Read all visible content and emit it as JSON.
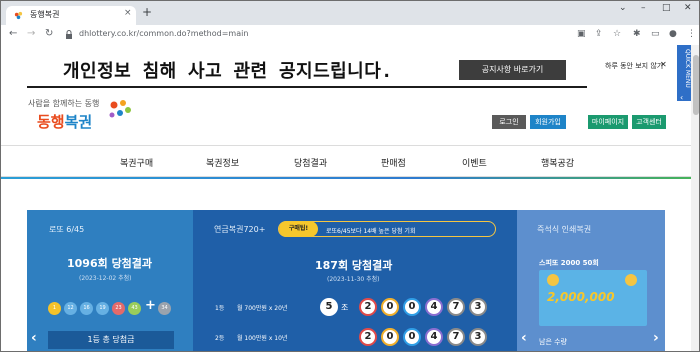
{
  "browser": {
    "tab_title": "동행복권",
    "tab_close": "×",
    "new_tab": "+",
    "url": "dhlottery.co.kr/common.do?method=main",
    "controls": {
      "minimize": "–",
      "maximize": "□",
      "close": "✕"
    }
  },
  "banner": {
    "text": "개인정보 침해 사고 관련 공지드립니다.",
    "button": "공지사항 바로가기",
    "hide_today": "하루 동안 보지 않기",
    "close": "✕"
  },
  "quick_menu": {
    "label": "QUICK MENU",
    "chevron": "‹"
  },
  "header": {
    "tagline": "사람을 함께하는 동행",
    "logo_a": "동행",
    "logo_b": "복권",
    "buttons": {
      "login": "로그인",
      "signup": "회원가입",
      "mypage": "마이페이지",
      "support": "고객센터"
    }
  },
  "nav": [
    "복권구매",
    "복권정보",
    "당첨결과",
    "판매점",
    "이벤트",
    "행복공감"
  ],
  "lotto645": {
    "title": "로또 6/45",
    "round": "1096회 당첨결과",
    "date": "(2023-12-02 추첨)",
    "numbers": [
      "1",
      "12",
      "16",
      "19",
      "23",
      "43"
    ],
    "bonus": "34",
    "button": "1등 총 당첨금"
  },
  "pension720": {
    "title": "연금복권720+",
    "pill_tag": "구매팁!",
    "pill_text": "로또6/45보다 14배 높은 당첨 기회",
    "round": "187회 당첨결과",
    "date": "(2023-11-30 추첨)",
    "row1": {
      "rank": "1등",
      "prize": "월 700만원 x 20년",
      "group": "5",
      "jo": "조",
      "numbers": [
        "2",
        "0",
        "0",
        "4",
        "7",
        "3"
      ]
    },
    "row2": {
      "rank": "2등",
      "prize": "월 100만원 x 10년",
      "numbers": [
        "2",
        "0",
        "0",
        "4",
        "7",
        "3"
      ]
    }
  },
  "instant": {
    "title": "즉석식 인쇄복권",
    "ticket_name": "스피또 2000 50회",
    "ticket_amount": "2,000,000",
    "bottom": "남은 수량"
  },
  "colors": {
    "panel_left": "#2f7fc0",
    "panel_mid": "#1f5fa8",
    "panel_right": "#5d8fce",
    "banner_btn": "#3d3d3d",
    "logo_orange": "#e94c1f",
    "logo_blue": "#1e84c8"
  },
  "icons": [
    "back-icon",
    "forward-icon",
    "reload-icon",
    "lock-icon",
    "share-icon",
    "star-icon",
    "extension-icon",
    "profile-icon",
    "kebab-icon"
  ]
}
